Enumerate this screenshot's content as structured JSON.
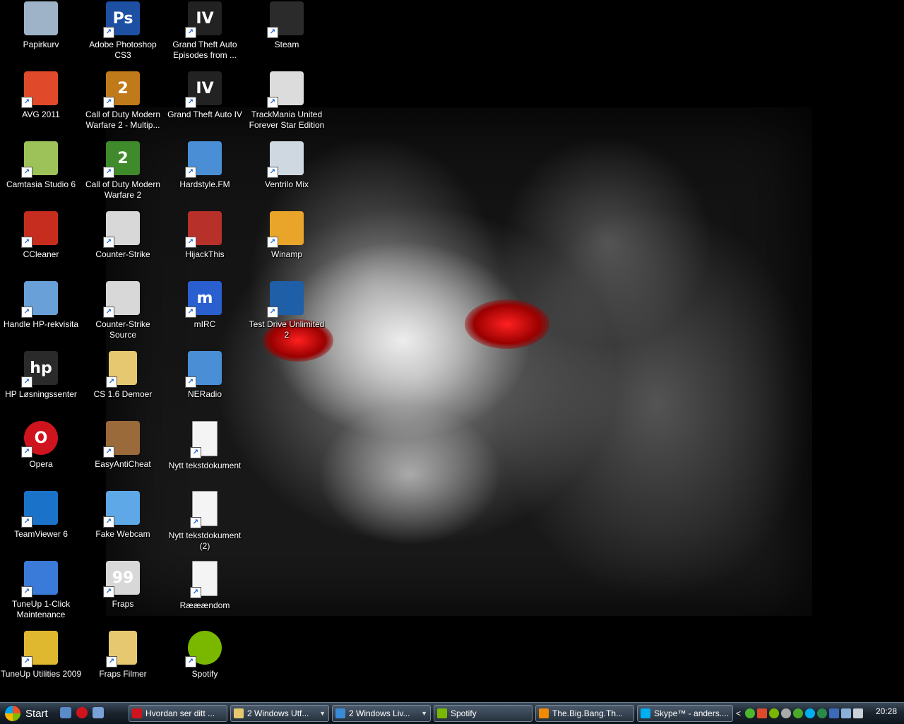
{
  "desktop": {
    "icons": [
      {
        "label": "Papirkurv",
        "icon": "recycle-bin-icon",
        "color": "#9fb3c8"
      },
      {
        "label": "Adobe Photoshop CS3",
        "icon": "photoshop-icon",
        "color": "#1d4fa3",
        "glyph": "Ps"
      },
      {
        "label": "Grand Theft Auto Episodes from ...",
        "icon": "gta-iv-eflc-icon",
        "color": "#222222",
        "glyph": "IV"
      },
      {
        "label": "Steam",
        "icon": "steam-icon",
        "color": "#2b2b2b"
      },
      {
        "label": "AVG 2011",
        "icon": "avg-icon",
        "color": "#e04a2a"
      },
      {
        "label": "Call of Duty Modern Warfare 2 - Multip...",
        "icon": "cod-mw2-mp-icon",
        "color": "#c07a1a",
        "glyph": "2"
      },
      {
        "label": "Grand Theft Auto IV",
        "icon": "gta-iv-icon",
        "color": "#222222",
        "glyph": "IV"
      },
      {
        "label": "TrackMania United Forever Star Edition",
        "icon": "trackmania-icon",
        "color": "#dcdcdc"
      },
      {
        "label": "Camtasia Studio 6",
        "icon": "camtasia-icon",
        "color": "#9ec25a"
      },
      {
        "label": "Call of Duty Modern Warfare 2",
        "icon": "cod-mw2-icon",
        "color": "#3f8a2a",
        "glyph": "2"
      },
      {
        "label": "Hardstyle.FM",
        "icon": "winamp-playlist-icon",
        "color": "#4a8fd6"
      },
      {
        "label": "Ventrilo Mix",
        "icon": "ventrilo-icon",
        "color": "#cfd8e0"
      },
      {
        "label": "CCleaner",
        "icon": "ccleaner-icon",
        "color": "#c62d1f"
      },
      {
        "label": "Counter-Strike",
        "icon": "counter-strike-icon",
        "color": "#d8d8d8"
      },
      {
        "label": "HijackThis",
        "icon": "hijackthis-icon",
        "color": "#b8302a"
      },
      {
        "label": "Winamp",
        "icon": "winamp-icon",
        "color": "#e8a52a"
      },
      {
        "label": "Handle HP-rekvisita",
        "icon": "hp-supplies-icon",
        "color": "#6aa0d8"
      },
      {
        "label": "Counter-Strike Source",
        "icon": "counter-strike-source-icon",
        "color": "#d8d8d8"
      },
      {
        "label": "mIRC",
        "icon": "mirc-icon",
        "color": "#2a5fd0",
        "glyph": "m"
      },
      {
        "label": "Test Drive Unlimited 2",
        "icon": "test-drive-icon",
        "color": "#1f5fa8"
      },
      {
        "label": "HP Løsningssenter",
        "icon": "hp-solution-center-icon",
        "color": "#2a2a2a",
        "glyph": "hp"
      },
      {
        "label": "CS 1.6 Demoer",
        "icon": "folder-icon",
        "color": "#e6c870"
      },
      {
        "label": "NERadio",
        "icon": "winamp-playlist-icon",
        "color": "#4a8fd6"
      },
      {
        "label": "Opera",
        "icon": "opera-icon",
        "color": "#d0141e",
        "glyph": "O"
      },
      {
        "label": "EasyAntiCheat",
        "icon": "easyanticheat-icon",
        "color": "#9a6a3a"
      },
      {
        "label": "Nytt tekstdokument",
        "icon": "text-document-icon",
        "color": "#f4f4f4"
      },
      {
        "label": "TeamViewer 6",
        "icon": "teamviewer-icon",
        "color": "#1a73c9"
      },
      {
        "label": "Fake Webcam",
        "icon": "fake-webcam-icon",
        "color": "#5ea8e8"
      },
      {
        "label": "Nytt tekstdokument (2)",
        "icon": "text-document-icon",
        "color": "#f4f4f4"
      },
      {
        "label": "TuneUp 1-Click Maintenance",
        "icon": "tuneup-maintenance-icon",
        "color": "#3a7ad8"
      },
      {
        "label": "Fraps",
        "icon": "fraps-icon",
        "color": "#d8d8d8",
        "glyph": "99"
      },
      {
        "label": "Rææændom",
        "icon": "text-document-icon",
        "color": "#f4f4f4"
      },
      {
        "label": "TuneUp Utilities 2009",
        "icon": "tuneup-utilities-icon",
        "color": "#e0b830"
      },
      {
        "label": "Fraps Filmer",
        "icon": "folder-icon",
        "color": "#e6c870"
      },
      {
        "label": "Spotify",
        "icon": "spotify-icon",
        "color": "#7ab800"
      }
    ]
  },
  "taskbar": {
    "start_label": "Start",
    "tasks": [
      {
        "label": "Hvordan ser ditt ...",
        "icon": "opera-icon",
        "color": "#d0141e"
      },
      {
        "label": "2 Windows Utf...",
        "icon": "folder-icon",
        "color": "#e6c870"
      },
      {
        "label": "2 Windows Liv...",
        "icon": "windows-live-icon",
        "color": "#3a8ad8"
      },
      {
        "label": "Spotify",
        "icon": "spotify-icon",
        "color": "#7ab800"
      },
      {
        "label": "The.Big.Bang.Th...",
        "icon": "vlc-icon",
        "color": "#f08a00"
      },
      {
        "label": "Skype™ - anders....",
        "icon": "skype-icon",
        "color": "#00aff0"
      }
    ],
    "tray_chevron": "<",
    "clock": "20:28"
  }
}
